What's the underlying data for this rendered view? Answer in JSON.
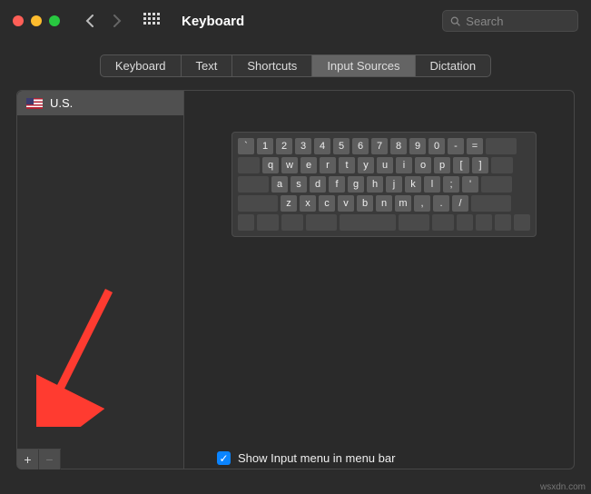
{
  "window": {
    "title": "Keyboard"
  },
  "search": {
    "placeholder": "Search"
  },
  "tabs": [
    {
      "label": "Keyboard"
    },
    {
      "label": "Text"
    },
    {
      "label": "Shortcuts"
    },
    {
      "label": "Input Sources",
      "active": true
    },
    {
      "label": "Dictation"
    }
  ],
  "sources": [
    {
      "name": "U.S.",
      "flag": "us"
    }
  ],
  "keyboard": {
    "row1": [
      "`",
      "1",
      "2",
      "3",
      "4",
      "5",
      "6",
      "7",
      "8",
      "9",
      "0",
      "-",
      "="
    ],
    "row2": [
      "q",
      "w",
      "e",
      "r",
      "t",
      "y",
      "u",
      "i",
      "o",
      "p",
      "[",
      "]"
    ],
    "row3": [
      "a",
      "s",
      "d",
      "f",
      "g",
      "h",
      "j",
      "k",
      "l",
      ";",
      "'"
    ],
    "row4": [
      "z",
      "x",
      "c",
      "v",
      "b",
      "n",
      "m",
      ",",
      ".",
      "/"
    ]
  },
  "buttons": {
    "add": "+",
    "remove": "−"
  },
  "checkbox": {
    "label": "Show Input menu in menu bar",
    "checked": true
  },
  "watermark": "wsxdn.com"
}
